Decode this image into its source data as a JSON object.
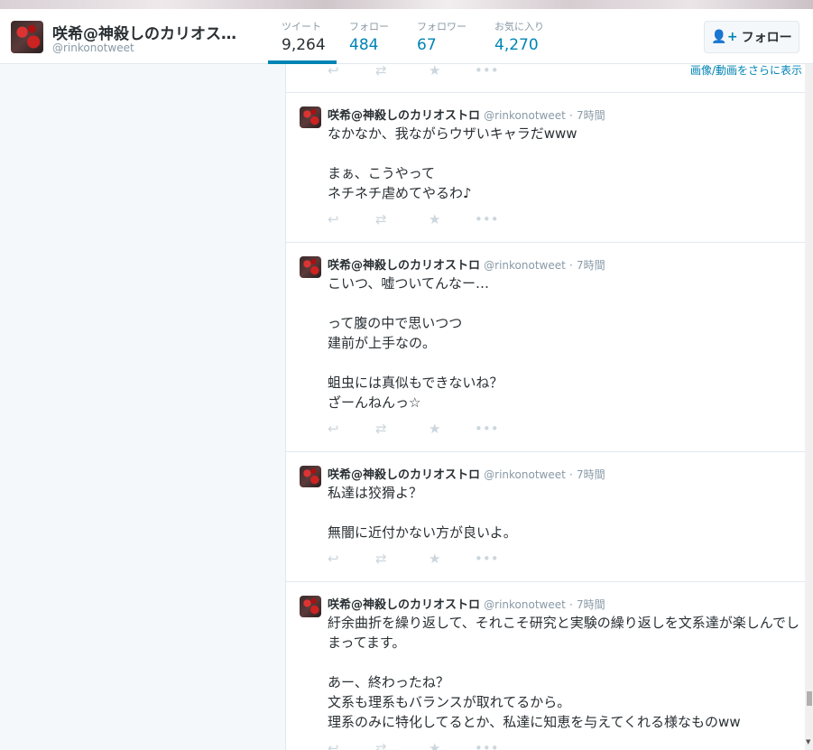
{
  "profile": {
    "name": "咲希@神殺しのカリオス…",
    "handle": "@rinkonotweet"
  },
  "stats": [
    {
      "label": "ツイート",
      "value": "9,264"
    },
    {
      "label": "フォロー",
      "value": "484"
    },
    {
      "label": "フォロワー",
      "value": "67"
    },
    {
      "label": "お気に入り",
      "value": "4,270"
    }
  ],
  "follow_button": {
    "icon": "add-user-icon",
    "label": "フォロー"
  },
  "more_media_link": "画像/動画をさらに表示",
  "action_icons": {
    "reply": "↩",
    "retweet": "⇄",
    "favorite": "★",
    "more": "•••"
  },
  "tweets": [
    {
      "name": "咲希@神殺しのカリオストロ",
      "handle": "@rinkonotweet",
      "time": "7時間",
      "text": "なかなか、我ながらウザいキャラだwww\n\nまぁ、こうやって\nネチネチ虐めてやるわ♪"
    },
    {
      "name": "咲希@神殺しのカリオストロ",
      "handle": "@rinkonotweet",
      "time": "7時間",
      "text": "こいつ、嘘ついてんなー…\n\nって腹の中で思いつつ\n建前が上手なの。\n\n蛆虫には真似もできないね？\nざーんねんっ☆"
    },
    {
      "name": "咲希@神殺しのカリオストロ",
      "handle": "@rinkonotweet",
      "time": "7時間",
      "text": "私達は狡猾よ？\n\n無闇に近付かない方が良いよ。"
    },
    {
      "name": "咲希@神殺しのカリオストロ",
      "handle": "@rinkonotweet",
      "time": "7時間",
      "text": "紆余曲折を繰り返して、それこそ研究と実験の繰り返しを文系達が楽しんでしまってます。\n\nあー、終わったね？\n文系も理系もバランスが取れてるから。\n理系のみに特化してるとか、私達に知恵を与えてくれる様なものww"
    }
  ]
}
